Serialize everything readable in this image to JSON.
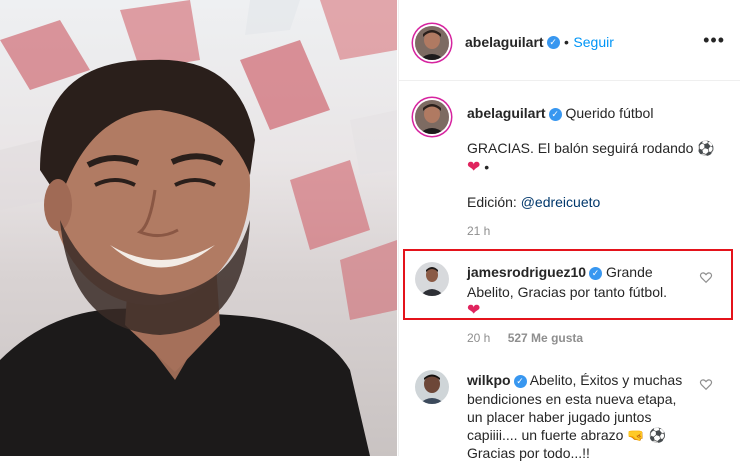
{
  "post": {
    "author": "abelaguilart",
    "follow_separator": "•",
    "follow_label": "Seguir",
    "more_label": "•••"
  },
  "caption": {
    "username": "abelaguilart",
    "line1": "Querido fútbol",
    "line2": "GRACIAS. El balón seguirá rodando",
    "line3_suffix": "•",
    "edition_prefix": "Edición:",
    "edition_link": "@edreicueto",
    "time": "21 h"
  },
  "comments": [
    {
      "username": "jamesrodriguez10",
      "text_line1": "Grande",
      "text_line2": "Abelito, Gracias por tanto fútbol.",
      "time": "20 h",
      "likes": "527 Me gusta"
    },
    {
      "username": "wilkpo",
      "text_line1": "Abelito, Éxitos y muchas",
      "text_line2": "bendiciones en esta nueva etapa,",
      "text_line3": "un placer haber jugado juntos",
      "text_line4": "capiiii.... un fuerte abrazo",
      "text_line5": "Gracias por todo...!!"
    }
  ],
  "colors": {
    "verified": "#3897f0",
    "follow": "#0095f6",
    "highlight": "#e4131b",
    "heart": "#e0245e"
  },
  "icons": [
    "verified-badge-icon",
    "heart-icon",
    "soccer-ball-icon",
    "fist-icon",
    "more-options-icon"
  ]
}
